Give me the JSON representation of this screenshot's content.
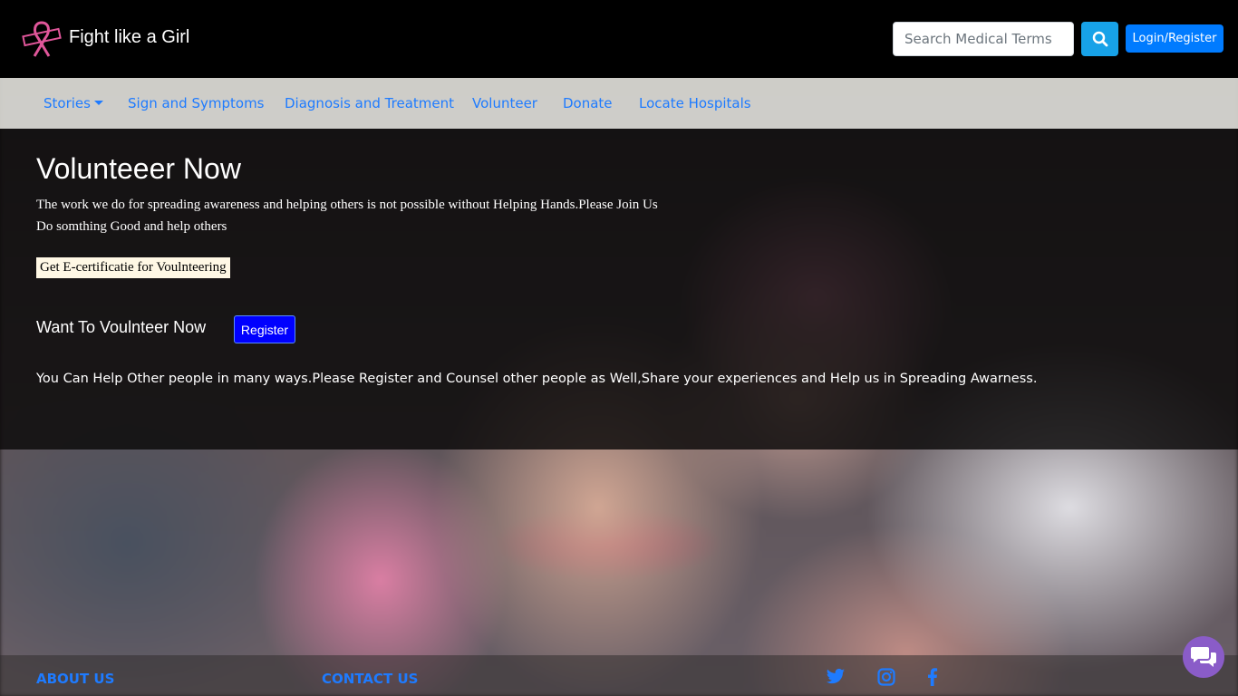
{
  "header": {
    "brand": "Fight like a Girl",
    "search": {
      "placeholder": "Search Medical Terms"
    },
    "login_label": "Login/Register"
  },
  "nav": {
    "items": [
      {
        "label": "Stories"
      },
      {
        "label": "Sign and Symptoms"
      },
      {
        "label": "Diagnosis and Treatment"
      },
      {
        "label": "Volunteer"
      },
      {
        "label": "Donate"
      },
      {
        "label": "Locate Hospitals"
      }
    ]
  },
  "main": {
    "title": "Volunteeer Now",
    "description_line1": "The work we do for spreading awareness and helping others is not possible without Helping Hands.Please Join Us",
    "description_line2": "Do somthing Good and help others",
    "certificate_text": "Get E-certificatie for Voulnteering",
    "want_text": "Want To Voulnteer Now",
    "register_label": "Register",
    "help_text": "You Can Help Other people in many ways.Please Register and Counsel other people as Well,Share your experiences and Help us in Spreading Awarness."
  },
  "footer": {
    "about_label": "ABOUT US",
    "contact_label": "CONTACT US"
  },
  "colors": {
    "accent": "#007bff",
    "link": "#1e7bff",
    "search_button": "#17a2e8",
    "register_button": "#0000ff",
    "chat_button": "#8a5cc8",
    "logo_ribbon": "#e0569a"
  },
  "icons": {
    "logo": "pink-ribbon-icon",
    "search": "search-icon",
    "social": [
      "twitter-icon",
      "instagram-icon",
      "facebook-icon"
    ],
    "chat": "chat-bubbles-icon"
  }
}
